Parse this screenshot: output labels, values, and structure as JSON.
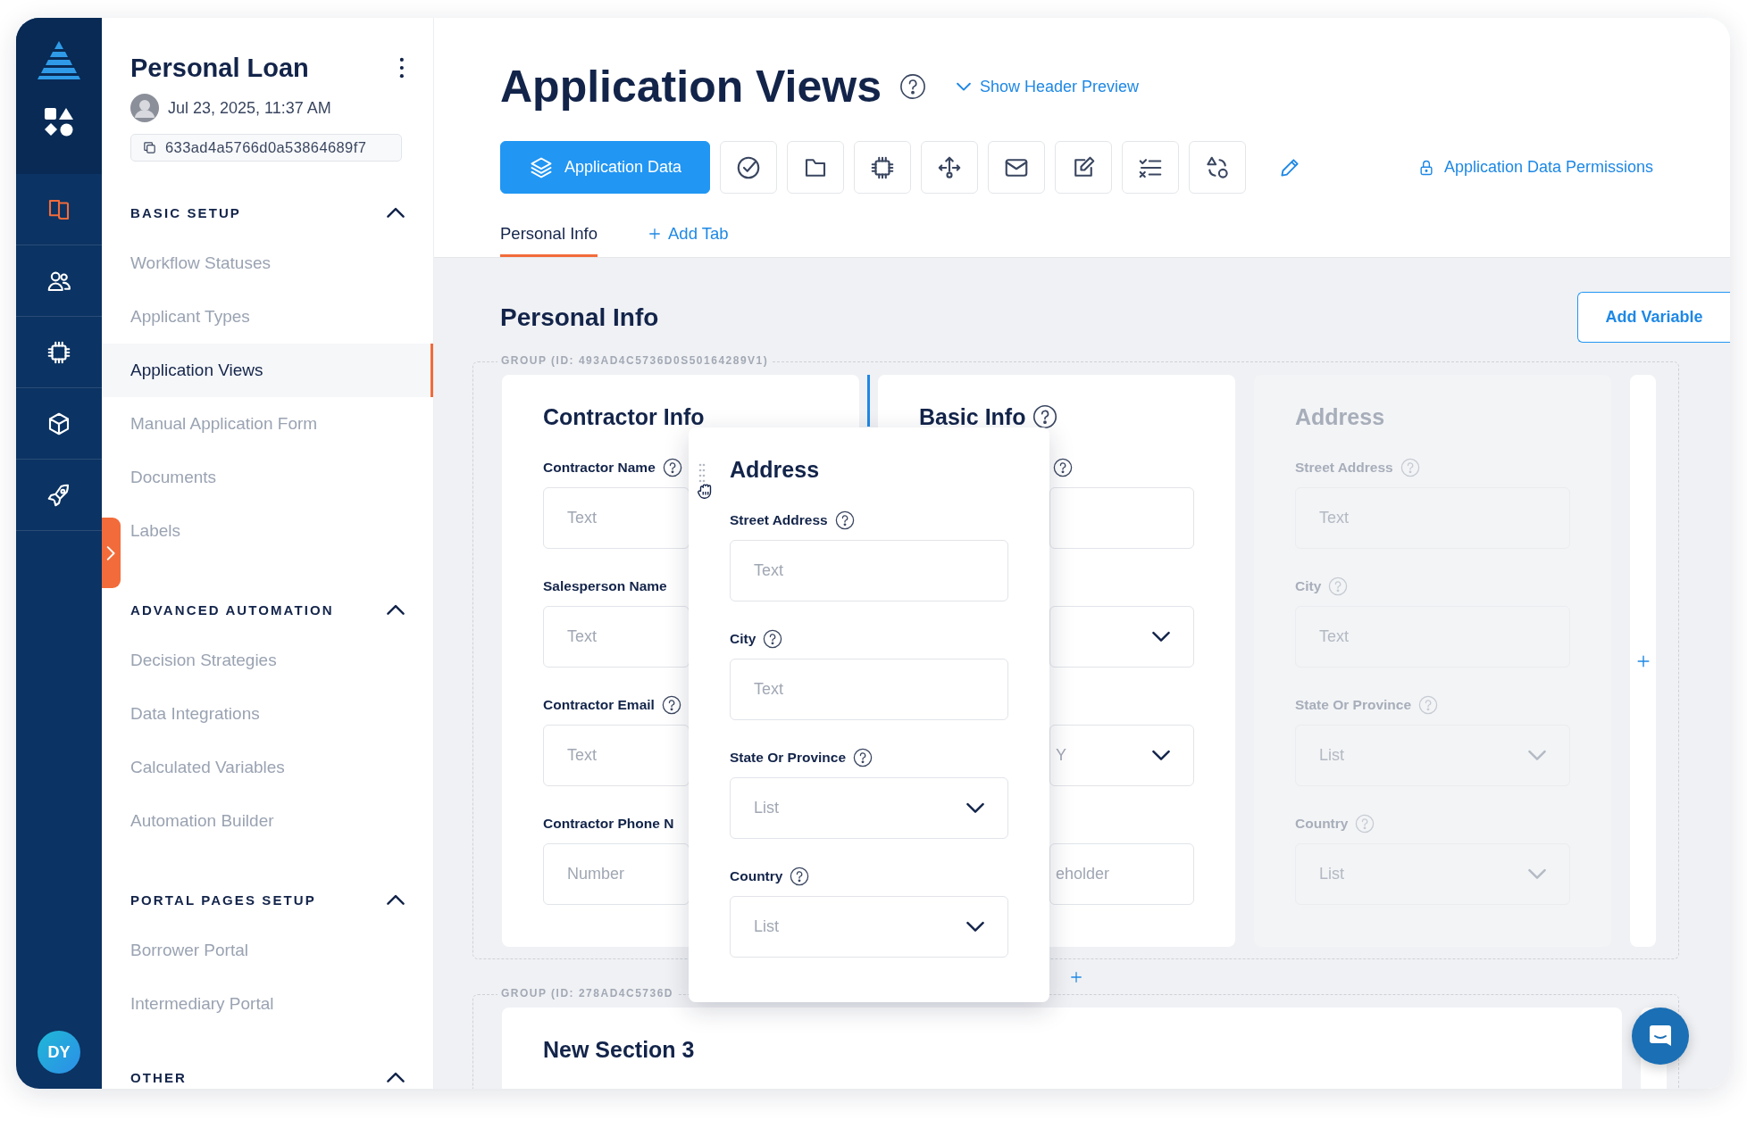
{
  "rail_items": [
    {
      "selected": true
    },
    {
      "selected": false
    },
    {
      "selected": false
    },
    {
      "selected": false
    },
    {
      "selected": false
    }
  ],
  "user": {
    "initials": "DY"
  },
  "sidebar": {
    "title": "Personal Loan",
    "date": "Jul 23, 2025, 11:37 AM",
    "id": "633ad4a5766d0a53864689f7",
    "sections": [
      {
        "title": "BASIC SETUP",
        "expanded": true,
        "items": [
          {
            "label": "Workflow Statuses",
            "selected": false
          },
          {
            "label": "Applicant Types",
            "selected": false
          },
          {
            "label": "Application Views",
            "selected": true
          },
          {
            "label": "Manual Application Form",
            "selected": false
          },
          {
            "label": "Documents",
            "selected": false
          },
          {
            "label": "Labels",
            "selected": false
          }
        ]
      },
      {
        "title": "ADVANCED AUTOMATION",
        "expanded": true,
        "items": [
          {
            "label": "Decision Strategies",
            "selected": false
          },
          {
            "label": "Data Integrations",
            "selected": false
          },
          {
            "label": "Calculated Variables",
            "selected": false
          },
          {
            "label": "Automation Builder",
            "selected": false
          }
        ]
      },
      {
        "title": "PORTAL PAGES SETUP",
        "expanded": true,
        "items": [
          {
            "label": "Borrower Portal",
            "selected": false
          },
          {
            "label": "Intermediary Portal",
            "selected": false
          }
        ]
      },
      {
        "title": "OTHER",
        "expanded": true
      }
    ]
  },
  "header": {
    "title": "Application Views",
    "preview_link": "Show Header Preview",
    "toolbar": [
      {
        "label": "Application Data",
        "selected": true
      },
      {
        "selected": false
      },
      {
        "selected": false
      },
      {
        "selected": false
      },
      {
        "selected": false
      },
      {
        "selected": false
      },
      {
        "selected": false
      },
      {
        "selected": false
      },
      {
        "selected": false
      }
    ],
    "permissions_link": "Application Data Permissions",
    "tabs": [
      {
        "label": "Personal Info",
        "selected": true
      }
    ],
    "add_tab": "Add Tab"
  },
  "page": {
    "heading": "Personal Info",
    "add_button": "Add Variable",
    "groups": [
      {
        "label": "GROUP (ID: 493AD4C5736D0S50164289V1)",
        "sections": [
          {
            "title": "Contractor Info",
            "help": false,
            "disabled": false,
            "drop_target": false,
            "fields": [
              {
                "kind": "text",
                "label": "Contractor Name",
                "help": true,
                "placeholder": "Text"
              },
              {
                "kind": "text",
                "label": "Salesperson Name",
                "help": false,
                "placeholder": "Text"
              },
              {
                "kind": "text",
                "label": "Contractor Email",
                "help": true,
                "placeholder": "Text"
              },
              {
                "kind": "text",
                "label": "Contractor Phone N",
                "help": false,
                "placeholder": "Number"
              }
            ]
          },
          {
            "title": "Basic Info",
            "help": true,
            "disabled": false,
            "drop_target": true,
            "fields": [
              {
                "kind": "text",
                "help": true
              },
              {
                "kind": "select",
                "help": false
              },
              {
                "kind": "select",
                "help": false,
                "placeholder": "Y"
              },
              {
                "kind": "text",
                "help": false,
                "placeholder": "eholder"
              }
            ]
          },
          {
            "title": "Address",
            "help": false,
            "disabled": true,
            "drop_target": false,
            "fields": [
              {
                "kind": "text",
                "label": "Street Address",
                "help": true,
                "placeholder": "Text"
              },
              {
                "kind": "text",
                "label": "City",
                "help": true,
                "placeholder": "Text"
              },
              {
                "kind": "select",
                "label": "State Or Province",
                "help": true,
                "placeholder": "List"
              },
              {
                "kind": "select",
                "label": "Country",
                "help": true,
                "placeholder": "List"
              }
            ]
          }
        ]
      },
      {
        "label": "GROUP (ID: 278AD4C5736D",
        "sections": [
          {
            "title": "New Section 3",
            "help": false,
            "disabled": false,
            "drop_target": false
          }
        ]
      }
    ],
    "dragged_section": {
      "title": "Address",
      "help": false,
      "disabled": false,
      "drop_target": false,
      "fields": [
        {
          "kind": "text",
          "label": "Street Address",
          "help": true,
          "placeholder": "Text"
        },
        {
          "kind": "text",
          "label": "City",
          "help": true,
          "placeholder": "Text"
        },
        {
          "kind": "select",
          "label": "State Or Province",
          "help": true,
          "placeholder": "List"
        },
        {
          "kind": "select",
          "label": "Country",
          "help": true,
          "placeholder": "List"
        }
      ]
    }
  }
}
